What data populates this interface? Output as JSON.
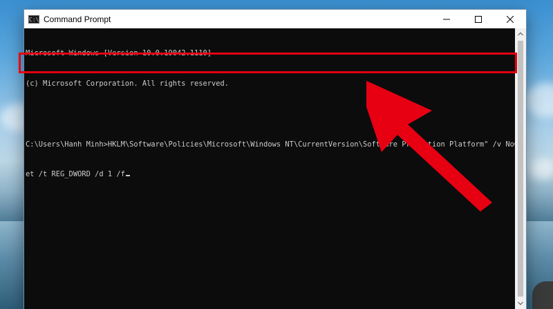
{
  "window": {
    "title": "Command Prompt",
    "icon": "cmd-icon",
    "controls": [
      "minimize-icon",
      "maximize-icon",
      "close-icon"
    ]
  },
  "console": {
    "lines": [
      "Microsoft Windows [Version 10.0.19042.1110]",
      "(c) Microsoft Corporation. All rights reserved.",
      "",
      "C:\\Users\\Hanh Minh>HKLM\\Software\\Policies\\Microsoft\\Windows NT\\CurrentVersion\\Software Protection Platform\" /v NoGenTick",
      "et /t REG_DWORD /d 1 /f"
    ]
  },
  "annotation": {
    "highlight_color": "#e60012",
    "arrow_color": "#e60012"
  }
}
